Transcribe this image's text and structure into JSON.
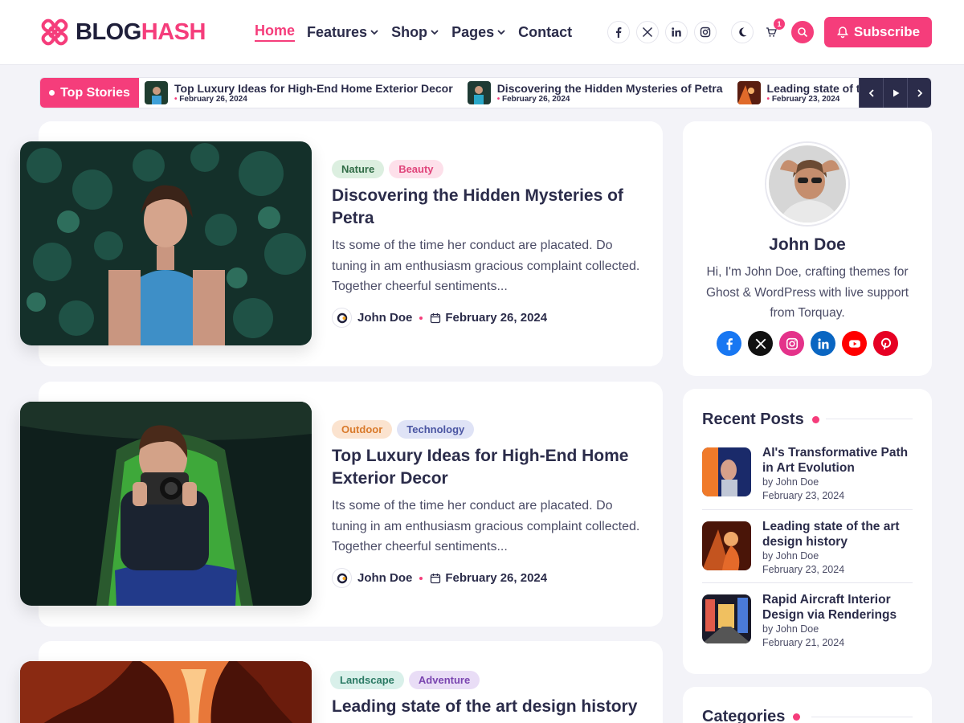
{
  "brand": {
    "name_part1": "BLOG",
    "name_part2": "HASH",
    "accent": "#f53d7b",
    "dark": "#2b2c4a"
  },
  "nav": {
    "items": [
      {
        "label": "Home",
        "active": true,
        "dropdown": false
      },
      {
        "label": "Features",
        "active": false,
        "dropdown": true
      },
      {
        "label": "Shop",
        "active": false,
        "dropdown": true
      },
      {
        "label": "Pages",
        "active": false,
        "dropdown": true
      },
      {
        "label": "Contact",
        "active": false,
        "dropdown": false
      }
    ]
  },
  "header": {
    "social_icons": [
      "facebook-icon",
      "x-icon",
      "linkedin-icon",
      "instagram-icon"
    ],
    "cart_count": "1",
    "subscribe_label": "Subscribe"
  },
  "ticker": {
    "label": "Top Stories",
    "items": [
      {
        "title": "Top Luxury Ideas for High-End Home Exterior Decor",
        "date": "February 26, 2024"
      },
      {
        "title": "Discovering the Hidden Mysteries of Petra",
        "date": "February 26, 2024"
      },
      {
        "title": "Leading state of the art design history",
        "date": "February 23, 2024"
      }
    ]
  },
  "posts": [
    {
      "tags": [
        {
          "label": "Nature",
          "bg": "#dcefe0",
          "fg": "#2f6b45"
        },
        {
          "label": "Beauty",
          "bg": "#fde0ea",
          "fg": "#e0457b"
        }
      ],
      "title": "Discovering the Hidden Mysteries of Petra",
      "excerpt": "Its some of the time her conduct are placated. Do tuning in am enthusiasm gracious complaint collected. Together cheerful sentiments...",
      "author": "John Doe",
      "date": "February 26, 2024"
    },
    {
      "tags": [
        {
          "label": "Outdoor",
          "bg": "#fbe3cf",
          "fg": "#d97a2b"
        },
        {
          "label": "Technology",
          "bg": "#dfe3f6",
          "fg": "#4a55a2"
        }
      ],
      "title": "Top Luxury Ideas for High-End Home Exterior Decor",
      "excerpt": "Its some of the time her conduct are placated. Do tuning in am enthusiasm gracious complaint collected. Together cheerful sentiments...",
      "author": "John Doe",
      "date": "February 26, 2024"
    },
    {
      "tags": [
        {
          "label": "Landscape",
          "bg": "#d9f0ea",
          "fg": "#2b7a64"
        },
        {
          "label": "Adventure",
          "bg": "#e9ddf6",
          "fg": "#7a45b0"
        }
      ],
      "title": "Leading state of the art design history"
    }
  ],
  "author_widget": {
    "name": "John Doe",
    "bio": "Hi, I'm John Doe, crafting themes for Ghost & WordPress with live support from Torquay.",
    "social": [
      {
        "icon": "facebook-icon",
        "color": "#1877f2"
      },
      {
        "icon": "x-icon",
        "color": "#111111"
      },
      {
        "icon": "instagram-icon",
        "color": "#e4328a"
      },
      {
        "icon": "linkedin-icon",
        "color": "#0a66c2"
      },
      {
        "icon": "youtube-icon",
        "color": "#ff0000"
      },
      {
        "icon": "pinterest-icon",
        "color": "#e60023"
      }
    ]
  },
  "recent_posts": {
    "title": "Recent Posts",
    "items": [
      {
        "title": "AI's Transformative Path in Art Evolution",
        "by": "by John Doe",
        "date": "February 23, 2024"
      },
      {
        "title": "Leading state of the art design history",
        "by": "by John Doe",
        "date": "February 23, 2024"
      },
      {
        "title": "Rapid Aircraft Interior Design via Renderings",
        "by": "by John Doe",
        "date": "February 21, 2024"
      }
    ]
  },
  "categories": {
    "title": "Categories"
  }
}
